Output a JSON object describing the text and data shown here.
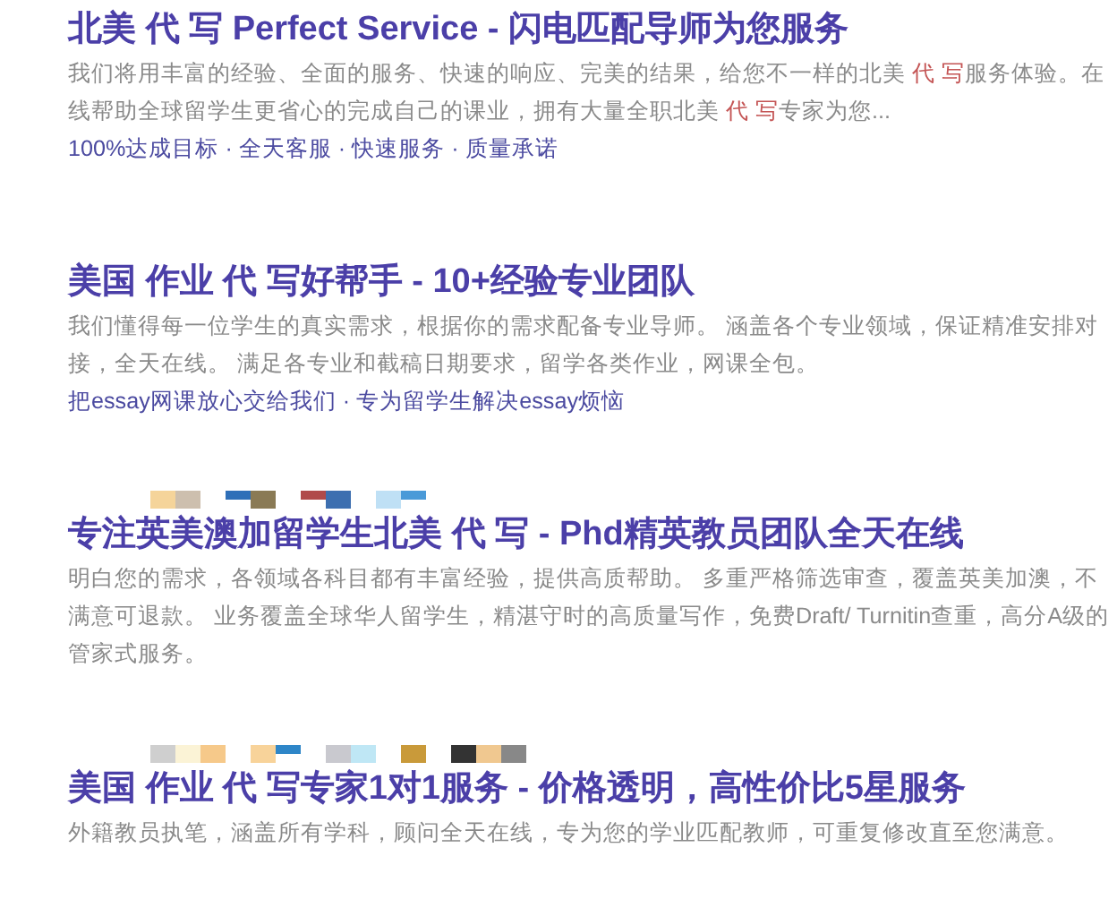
{
  "results": [
    {
      "title": "北美 代 写 Perfect Service - 闪电匹配导师为您服务",
      "snippet": [
        {
          "text": "我们将用丰富的经验、全面的服务、快速的响应、完美的结果，给您不一样的北美 ",
          "highlight": false
        },
        {
          "text": "代 写",
          "highlight": true
        },
        {
          "text": "服务体验。在线帮助全球留学生更省心的完成自己的课业，拥有大量全职北美 ",
          "highlight": false
        },
        {
          "text": "代 写",
          "highlight": true
        },
        {
          "text": "专家为您...",
          "highlight": false
        }
      ],
      "sitelinks": "100%达成目标 · 全天客服 · 快速服务 · 质量承诺"
    },
    {
      "title": "美国 作业 代 写好帮手 - 10+经验专业团队",
      "snippet": "我们懂得每一位学生的真实需求，根据你的需求配备专业导师。 涵盖各个专业领域，保证精准安排对接，全天在线。 满足各专业和截稿日期要求，留学各类作业，网课全包。",
      "sitelinks": "把essay网课放心交给我们 · 专为留学生解决essay烦恼"
    },
    {
      "title": "专注英美澳加留学生北美 代 写 - Phd精英教员团队全天在线",
      "snippet": "明白您的需求，各领域各科目都有丰富经验，提供高质帮助。 多重严格筛选审查，覆盖英美加澳，不满意可退款。 业务覆盖全球华人留学生，精湛守时的高质量写作，免费Draft/ Turnitin查重，高分A级的管家式服务。"
    },
    {
      "title": "美国 作业 代 写专家1对1服务 - 价格透明，高性价比5星服务",
      "snippet": "外籍教员执笔，涵盖所有学科，顾问全天在线，专为您的学业匹配教师，可重复修改直至您满意。"
    }
  ]
}
